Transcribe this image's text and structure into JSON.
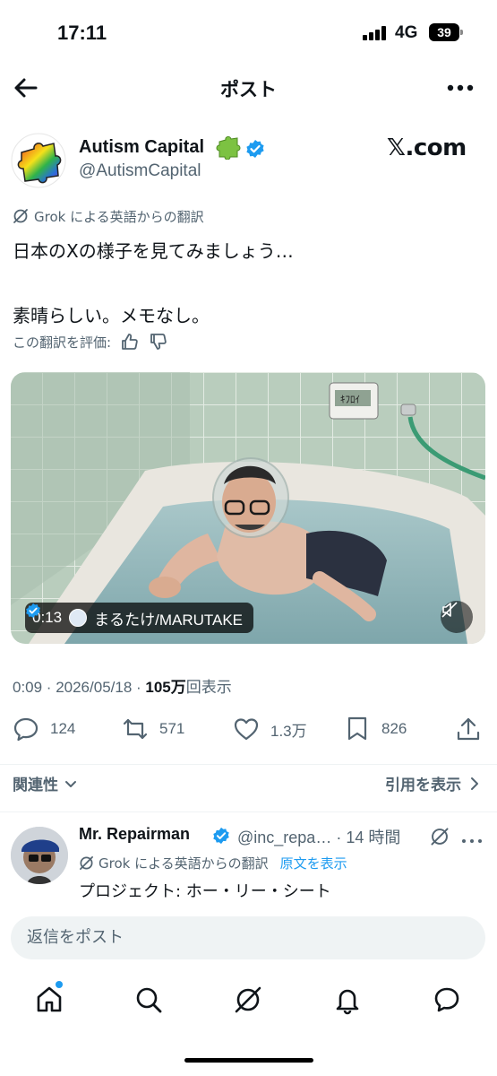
{
  "status_bar": {
    "time": "17:11",
    "network": "4G",
    "battery": "39"
  },
  "header": {
    "title": "ポスト"
  },
  "author": {
    "name": "Autism Capital",
    "handle": "@AutismCapital",
    "watermark": "𝕏.com"
  },
  "translation": {
    "label": "Grok による英語からの翻訳"
  },
  "tweet": {
    "text": "日本のXの様子を見てみましょう…\n\n素晴らしい。メモなし。"
  },
  "rate": {
    "label": "この翻訳を評価:"
  },
  "video": {
    "time": "0:13",
    "creator": "まるたけ/MARUTAKE",
    "panel_text": "ｷﾌﾛｲ"
  },
  "meta": {
    "time_date": "0:09 · 2026/05/18 · ",
    "views": "105万",
    "views_label": "回表示"
  },
  "actions": {
    "replies": "124",
    "reposts": "571",
    "likes": "1.3万",
    "bookmarks": "826"
  },
  "sort": {
    "left": "関連性",
    "right": "引用を表示"
  },
  "reply": {
    "name": "Mr. Repairman",
    "handle": "@inc_repa… · 14 時間",
    "translation_label": "Grok による英語からの翻訳",
    "show_original": "原文を表示",
    "text": "プロジェクト: ホー・リー・シート"
  },
  "compose": {
    "placeholder": "返信をポスト"
  },
  "colors": {
    "accent": "#1d9bf0",
    "text": "#0f1419",
    "muted": "#536471"
  },
  "icons": [
    "back-arrow-icon",
    "more-icon",
    "verified-icon",
    "grok-icon",
    "thumbs-up-icon",
    "thumbs-down-icon",
    "reply-icon",
    "repost-icon",
    "like-icon",
    "bookmark-icon",
    "share-icon",
    "chevron-down-icon",
    "chevron-right-icon",
    "home-icon",
    "search-icon",
    "grok-nav-icon",
    "bell-icon",
    "messages-icon",
    "mute-icon"
  ]
}
